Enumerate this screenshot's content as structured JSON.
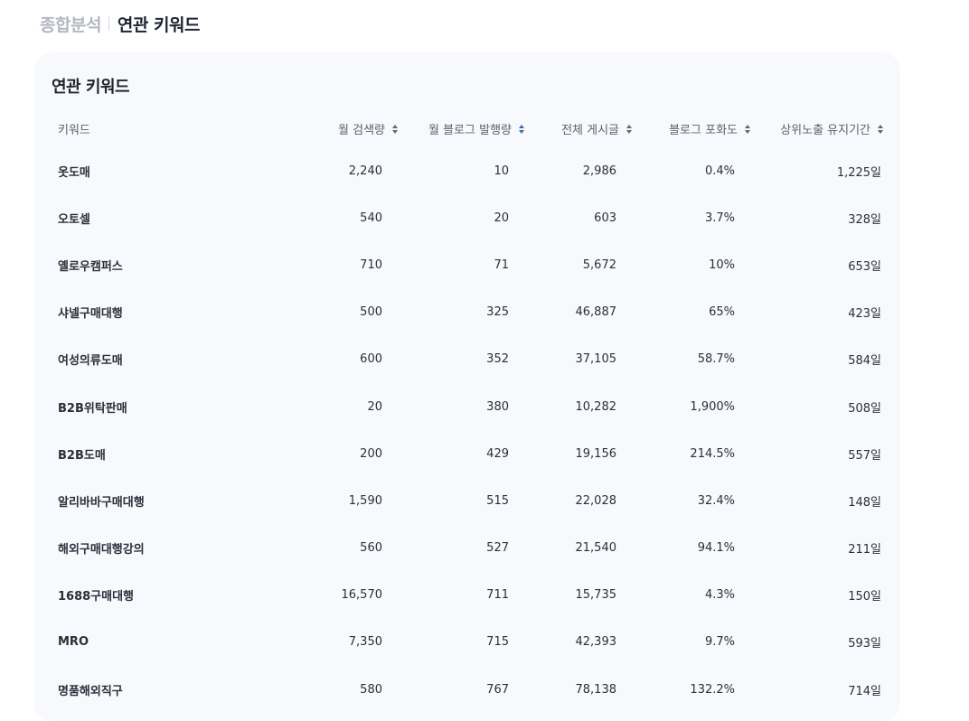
{
  "breadcrumb": {
    "parent": "종합분석",
    "current": "연관 키워드"
  },
  "card": {
    "title": "연관 키워드"
  },
  "table": {
    "columns": [
      {
        "label": "키워드",
        "sortable": false
      },
      {
        "label": "월 검색량",
        "sortable": true,
        "active": false
      },
      {
        "label": "월 블로그 발행량",
        "sortable": true,
        "active": true
      },
      {
        "label": "전체 게시글",
        "sortable": true,
        "active": false
      },
      {
        "label": "블로그 포화도",
        "sortable": true,
        "active": false
      },
      {
        "label": "상위노출 유지기간",
        "sortable": true,
        "active": false
      }
    ],
    "rows": [
      [
        "옷도매",
        "2,240",
        "10",
        "2,986",
        "0.4%",
        "1,225일"
      ],
      [
        "오토셀",
        "540",
        "20",
        "603",
        "3.7%",
        "328일"
      ],
      [
        "옐로우캠퍼스",
        "710",
        "71",
        "5,672",
        "10%",
        "653일"
      ],
      [
        "샤넬구매대행",
        "500",
        "325",
        "46,887",
        "65%",
        "423일"
      ],
      [
        "여성의류도매",
        "600",
        "352",
        "37,105",
        "58.7%",
        "584일"
      ],
      [
        "B2B위탁판매",
        "20",
        "380",
        "10,282",
        "1,900%",
        "508일"
      ],
      [
        "B2B도매",
        "200",
        "429",
        "19,156",
        "214.5%",
        "557일"
      ],
      [
        "알리바바구매대행",
        "1,590",
        "515",
        "22,028",
        "32.4%",
        "148일"
      ],
      [
        "해외구매대행강의",
        "560",
        "527",
        "21,540",
        "94.1%",
        "211일"
      ],
      [
        "1688구매대행",
        "16,570",
        "711",
        "15,735",
        "4.3%",
        "150일"
      ],
      [
        "MRO",
        "7,350",
        "715",
        "42,393",
        "9.7%",
        "593일"
      ],
      [
        "명품해외직구",
        "580",
        "767",
        "78,138",
        "132.2%",
        "714일"
      ]
    ]
  }
}
